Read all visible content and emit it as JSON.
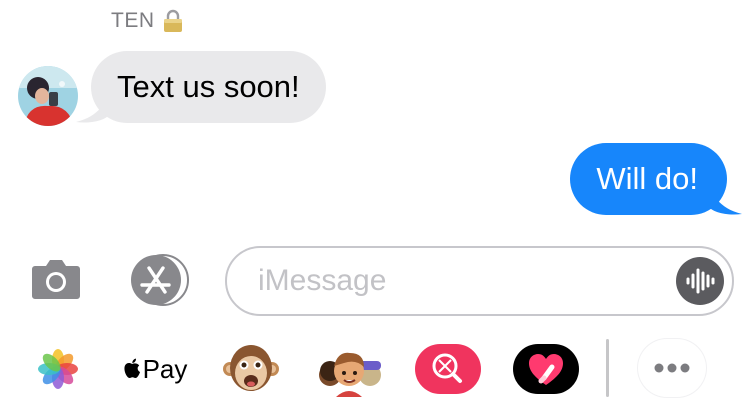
{
  "conversation": {
    "sender_name": "TEN",
    "messages": [
      {
        "direction": "incoming",
        "text": "Text us soon!"
      },
      {
        "direction": "outgoing",
        "text": "Will do!"
      }
    ]
  },
  "composer": {
    "placeholder": "iMessage",
    "value": ""
  },
  "app_tray": {
    "apple_pay_label": "Pay",
    "items": [
      "photos-icon",
      "apple-pay-icon",
      "monkey-memoji-icon",
      "memoji-stickers-icon",
      "image-search-icon",
      "digital-touch-icon",
      "more-icon"
    ]
  },
  "colors": {
    "incoming_bubble": "#e9e9eb",
    "outgoing_bubble": "#1786fb",
    "input_border": "#c7c7cc"
  }
}
